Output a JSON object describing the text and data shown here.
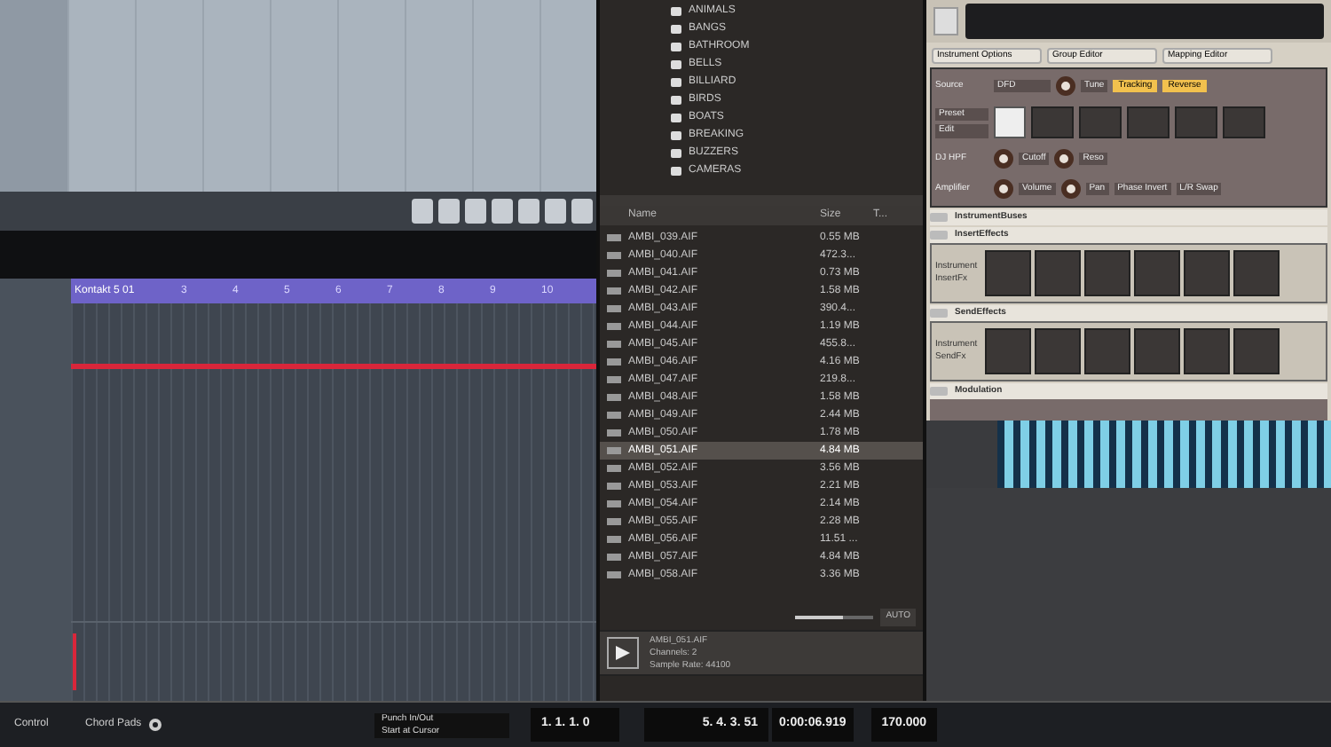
{
  "arrange": {
    "clip_label": "Kontakt 5 01",
    "ruler_marks": [
      "3",
      "4",
      "5",
      "6",
      "7",
      "8",
      "9",
      "10"
    ]
  },
  "browser": {
    "folders": [
      "ANIMALS",
      "BANGS",
      "BATHROOM",
      "BELLS",
      "BILLIARD",
      "BIRDS",
      "BOATS",
      "BREAKING",
      "BUZZERS",
      "CAMERAS"
    ],
    "columns": [
      "Name",
      "Size",
      "T..."
    ],
    "files": [
      {
        "name": "AMBI_039.AIF",
        "size": "0.55 MB",
        "selected": false
      },
      {
        "name": "AMBI_040.AIF",
        "size": "472.3...",
        "selected": false
      },
      {
        "name": "AMBI_041.AIF",
        "size": "0.73 MB",
        "selected": false
      },
      {
        "name": "AMBI_042.AIF",
        "size": "1.58 MB",
        "selected": false
      },
      {
        "name": "AMBI_043.AIF",
        "size": "390.4...",
        "selected": false
      },
      {
        "name": "AMBI_044.AIF",
        "size": "1.19 MB",
        "selected": false
      },
      {
        "name": "AMBI_045.AIF",
        "size": "455.8...",
        "selected": false
      },
      {
        "name": "AMBI_046.AIF",
        "size": "4.16 MB",
        "selected": false
      },
      {
        "name": "AMBI_047.AIF",
        "size": "219.8...",
        "selected": false
      },
      {
        "name": "AMBI_048.AIF",
        "size": "1.58 MB",
        "selected": false
      },
      {
        "name": "AMBI_049.AIF",
        "size": "2.44 MB",
        "selected": false
      },
      {
        "name": "AMBI_050.AIF",
        "size": "1.78 MB",
        "selected": false
      },
      {
        "name": "AMBI_051.AIF",
        "size": "4.84 MB",
        "selected": true
      },
      {
        "name": "AMBI_052.AIF",
        "size": "3.56 MB",
        "selected": false
      },
      {
        "name": "AMBI_053.AIF",
        "size": "2.21 MB",
        "selected": false
      },
      {
        "name": "AMBI_054.AIF",
        "size": "2.14 MB",
        "selected": false
      },
      {
        "name": "AMBI_055.AIF",
        "size": "2.28 MB",
        "selected": false
      },
      {
        "name": "AMBI_056.AIF",
        "size": "11.51 ...",
        "selected": false
      },
      {
        "name": "AMBI_057.AIF",
        "size": "4.84 MB",
        "selected": false
      },
      {
        "name": "AMBI_058.AIF",
        "size": "3.36 MB",
        "selected": false
      }
    ],
    "zoom": {
      "level": 0.6,
      "auto_label": "AUTO"
    },
    "preview": {
      "lines": [
        "AMBI_051.AIF",
        "Channels: 2",
        "Sample Rate: 44100"
      ]
    }
  },
  "kontakt": {
    "tabs": [
      "Instrument Options",
      "Group Editor",
      "Mapping Editor"
    ],
    "source": {
      "label": "Source",
      "mode": "DFD",
      "knob": "Tune",
      "buttons": [
        "Tracking",
        "Reverse"
      ]
    },
    "filter": {
      "label": "DJ HPF",
      "knobs": [
        "Cutoff",
        "Reso"
      ]
    },
    "amplifier": {
      "label": "Amplifier",
      "knobs": [
        "Volume",
        "Pan"
      ],
      "buttons": [
        "Phase Invert",
        "L/R Swap"
      ]
    },
    "sections": [
      {
        "label": "InstrumentBuses"
      },
      {
        "label": "InsertEffects",
        "slots": "Instrument InsertFx"
      },
      {
        "label": "SendEffects",
        "slots": "Instrument SendFx"
      },
      {
        "label": "Modulation"
      }
    ],
    "preset_label": "Preset",
    "edit_label": "Edit"
  },
  "bottom": {
    "tabs": [
      "Control",
      "Chord Pads"
    ],
    "options": [
      "Punch In/Out",
      "Start at Cursor"
    ],
    "position": "1. 1. 1. 0",
    "length": "5. 4. 3. 51",
    "time": "0:00:06.919",
    "tempo": "170.000"
  }
}
